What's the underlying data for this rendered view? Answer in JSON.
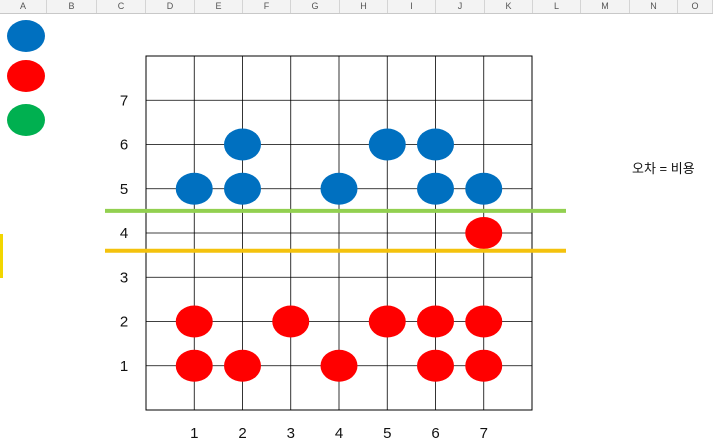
{
  "spreadsheet": {
    "columns": [
      "A",
      "B",
      "C",
      "D",
      "E",
      "F",
      "G",
      "H",
      "I",
      "J",
      "K",
      "L",
      "M",
      "N",
      "O"
    ]
  },
  "legend_markers": [
    {
      "color": "#0070c0"
    },
    {
      "color": "#ff0000"
    },
    {
      "color": "#00b050"
    }
  ],
  "note": {
    "text": "오차 = 비용"
  },
  "colors": {
    "blue": "#0070c0",
    "red": "#ff0000",
    "green_line": "#92d050",
    "orange_line": "#f4c20d",
    "grid": "#000000"
  },
  "chart_data": {
    "type": "scatter",
    "xlim": [
      0,
      8
    ],
    "ylim": [
      0,
      8
    ],
    "x_ticks": [
      "1",
      "2",
      "3",
      "4",
      "5",
      "6",
      "7"
    ],
    "y_ticks": [
      "1",
      "2",
      "3",
      "4",
      "5",
      "6",
      "7"
    ],
    "grid": true,
    "series": [
      {
        "color": "#0070c0",
        "points": [
          [
            1,
            5
          ],
          [
            2,
            5
          ],
          [
            2,
            6
          ],
          [
            4,
            5
          ],
          [
            5,
            6
          ],
          [
            6,
            6
          ],
          [
            6,
            5
          ],
          [
            7,
            5
          ]
        ]
      },
      {
        "color": "#ff0000",
        "points": [
          [
            1,
            1
          ],
          [
            1,
            2
          ],
          [
            2,
            1
          ],
          [
            3,
            2
          ],
          [
            4,
            1
          ],
          [
            5,
            2
          ],
          [
            6,
            2
          ],
          [
            6,
            1
          ],
          [
            7,
            2
          ],
          [
            7,
            1
          ],
          [
            7,
            4
          ]
        ]
      }
    ],
    "threshold_lines": [
      {
        "y": 4.5,
        "color": "#92d050"
      },
      {
        "y": 3.6,
        "color": "#f4c20d"
      }
    ]
  }
}
